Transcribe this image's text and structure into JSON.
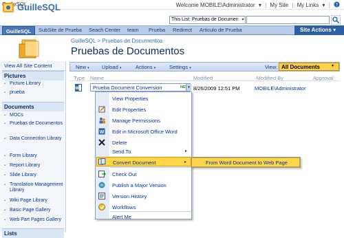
{
  "topbar": {
    "site_crumb": "GuilleSQL",
    "welcome": "Welcome MOBILE\\Administrator",
    "welcome_arrow": "▾",
    "sep1": "|",
    "my_site": "My Site",
    "sep2": "|",
    "my_links": "My Links",
    "my_links_arrow": "▾",
    "sep3": "|",
    "help_icon": "help-icon"
  },
  "header": {
    "site_title": "GuilleSQL",
    "search_scope": "This List: Pruebas de Documen",
    "search_value": ""
  },
  "nav": {
    "items": [
      "GuilleSQL",
      "SubSite de Prueba",
      "Seach Center",
      "team",
      "Prueba",
      "Redirect",
      "Articulo de Prueba"
    ],
    "site_actions": "Site Actions",
    "site_actions_arrow": "▾"
  },
  "page": {
    "breadcrumb": "GuilleSQL > Pruebas de Documentos",
    "title": "Pruebas de Documentos"
  },
  "leftnav": {
    "view_all": "View All Site Content",
    "pictures_head": "Pictures",
    "pictures": [
      "Picture Library",
      "prueba"
    ],
    "documents_head": "Documents",
    "documents": [
      "MOCs",
      "Pruebas de Documentos",
      "Data Connection Library",
      "Form Library",
      "Report Library",
      "Slide Library",
      "Translation Management Library",
      "Wiki Page Library",
      "Basic Page Gallery",
      "Web Part Pages Gallery"
    ],
    "lists_head": "Lists"
  },
  "toolbar": {
    "new": "New",
    "upload": "Upload",
    "actions": "Actions",
    "settings": "Settings",
    "arrow": "▾",
    "view_label": "View:",
    "view_value": "All Documents",
    "view_arrow": "▾"
  },
  "list": {
    "columns": [
      "Type",
      "Name",
      "Modified",
      "Modified By",
      "Approval"
    ],
    "row": {
      "name": "Prueba Document Conversion",
      "new_badge": "NEW",
      "modified": "8/26/2009 12:51 PM",
      "modified_by": "MOBILE\\Administrator",
      "dropdown_arrow": "▾"
    }
  },
  "menu": {
    "items": [
      "View Properties",
      "Edit Properties",
      "Manage Permissions",
      "Edit in Microsoft Office Word",
      "Delete",
      "Send To",
      "Convert Document",
      "Check Out",
      "Publish a Major Version",
      "Version History",
      "Workflows",
      "Alert Me"
    ],
    "submenu_arrow": "▸",
    "submenu_item": "From Word Document to Web Page"
  },
  "colors": {
    "nav_bg": "#b8cbe9",
    "site_actions_bg": "#2c5ea5",
    "highlight": "#ffd64a",
    "link": "#003399",
    "title": "#0a2c5c"
  }
}
